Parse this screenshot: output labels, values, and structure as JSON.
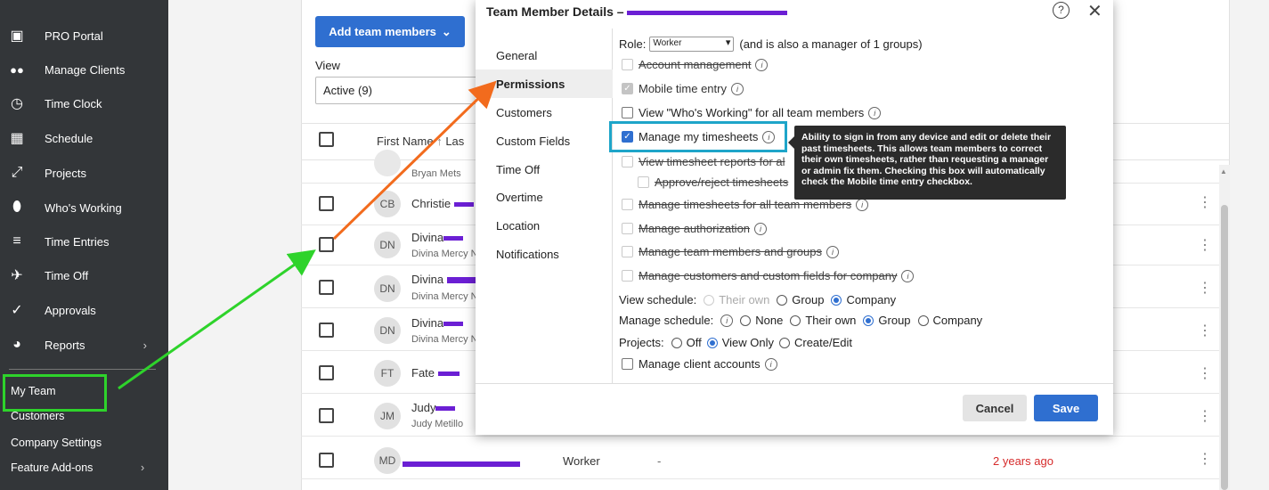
{
  "sidebar": {
    "items": [
      {
        "label": "PRO Portal",
        "icon": "portal-icon",
        "glyph": "▣"
      },
      {
        "label": "Manage Clients",
        "icon": "users-icon",
        "glyph": "👥"
      },
      {
        "label": "Time Clock",
        "icon": "clock-icon",
        "glyph": "◷"
      },
      {
        "label": "Schedule",
        "icon": "calendar-icon",
        "glyph": "▦"
      },
      {
        "label": "Projects",
        "icon": "projects-icon",
        "glyph": "⤢"
      },
      {
        "label": "Who's Working",
        "icon": "location-pin-icon",
        "glyph": "⬮"
      },
      {
        "label": "Time Entries",
        "icon": "time-entries-icon",
        "glyph": "≡"
      },
      {
        "label": "Time Off",
        "icon": "plane-icon",
        "glyph": "✈"
      },
      {
        "label": "Approvals",
        "icon": "check-icon",
        "glyph": "✓"
      },
      {
        "label": "Reports",
        "icon": "pie-chart-icon",
        "glyph": "◕",
        "chevron": "›"
      }
    ],
    "sub_items": [
      {
        "label": "My Team"
      },
      {
        "label": "Customers"
      },
      {
        "label": "Company Settings"
      },
      {
        "label": "Feature Add-ons",
        "chevron": "›"
      }
    ]
  },
  "main": {
    "add_button": "Add team members",
    "add_chevron": "⌄",
    "view_label": "View",
    "view_value": "Active (9)",
    "col_first_name": "First Name",
    "sort_glyph": "↑",
    "col_last_partial": "Las",
    "rows": [
      {
        "initials": "",
        "name": "",
        "sub": "Bryan Mets"
      },
      {
        "initials": "CB",
        "name": "Christie",
        "sub": ""
      },
      {
        "initials": "DN",
        "name": "Divina",
        "sub": "Divina Mercy N"
      },
      {
        "initials": "DN",
        "name": "Divina",
        "sub": "Divina Mercy N"
      },
      {
        "initials": "DN",
        "name": "Divina",
        "sub": "Divina Mercy N"
      },
      {
        "initials": "FT",
        "name": "Fate",
        "sub": ""
      },
      {
        "initials": "JM",
        "name": "Judy",
        "sub": "Judy Metillo"
      },
      {
        "initials": "MD",
        "name": "",
        "sub": "",
        "role": "Worker",
        "dash": "-",
        "last_seen": "2 years ago"
      }
    ],
    "kebab": "⋮"
  },
  "modal": {
    "title": "Team Member Details –",
    "help": "?",
    "close": "✕",
    "nav": [
      "General",
      "Permissions",
      "Customers",
      "Custom Fields",
      "Time Off",
      "Overtime",
      "Location",
      "Notifications"
    ],
    "active_nav": "Permissions",
    "role_label": "Role:",
    "role_value": "Worker",
    "role_suffix": "(and is also a manager of 1 groups)",
    "permissions": [
      {
        "label": "Account management",
        "state": "disabled-struck"
      },
      {
        "label": "Mobile time entry",
        "state": "checked-grey"
      },
      {
        "label": "View \"Who's Working\" for all team members",
        "state": "unchecked"
      },
      {
        "label": "Manage my timesheets",
        "state": "checked"
      },
      {
        "label": "View timesheet reports for al",
        "state": "disabled-struck"
      },
      {
        "label": "Approve/reject timesheets",
        "state": "disabled-struck"
      },
      {
        "label": "Manage timesheets for all team members",
        "state": "disabled-struck"
      },
      {
        "label": "Manage authorization",
        "state": "disabled-struck"
      },
      {
        "label": "Manage team members and groups",
        "state": "disabled-struck"
      },
      {
        "label": "Manage customers and custom fields for company",
        "state": "disabled-struck"
      }
    ],
    "view_schedule_label": "View schedule:",
    "view_schedule_options": [
      "Their own",
      "Group",
      "Company"
    ],
    "view_schedule_selected": "Company",
    "manage_schedule_label": "Manage schedule:",
    "manage_schedule_options": [
      "None",
      "Their own",
      "Group",
      "Company"
    ],
    "manage_schedule_selected": "Group",
    "projects_label": "Projects:",
    "projects_options": [
      "Off",
      "View Only",
      "Create/Edit"
    ],
    "projects_selected": "View Only",
    "manage_client_accounts": "Manage client accounts",
    "tooltip": "Ability to sign in from any device and edit or delete their past timesheets. This allows team members to correct their own timesheets, rather than requesting a manager or admin fix them. Checking this box will automatically check the Mobile time entry checkbox.",
    "cancel": "Cancel",
    "save": "Save"
  },
  "colors": {
    "sidebar_bg": "#333639",
    "primary_blue": "#2f6fd0",
    "redaction": "#6b1fd4",
    "green_annotation": "#2ed32b",
    "orange_annotation": "#f26b1d",
    "cyan_annotation": "#1ea5c9",
    "last_seen_red": "#d62b2b"
  }
}
